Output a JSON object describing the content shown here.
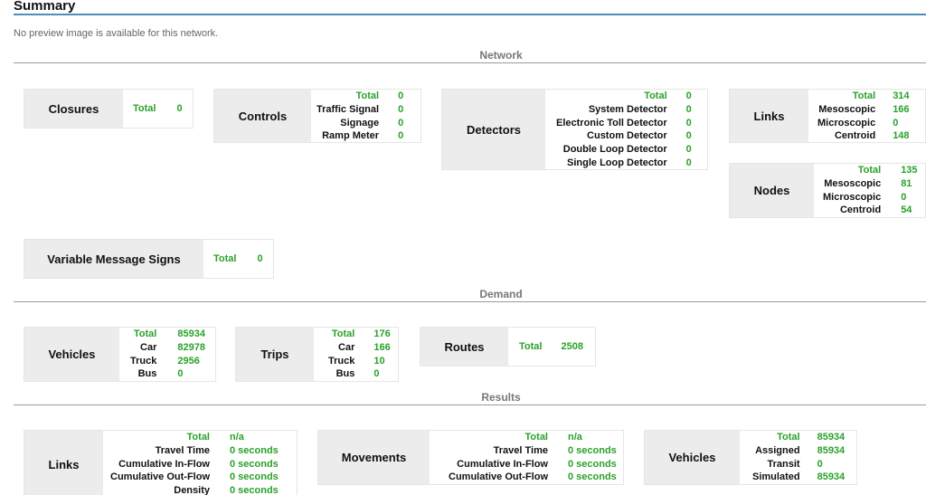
{
  "summary": {
    "title": "Summary",
    "no_preview": "No preview image is available for this network."
  },
  "sections": {
    "network": "Network",
    "demand": "Demand",
    "results": "Results"
  },
  "network": {
    "closures": {
      "label": "Closures",
      "total_label": "Total",
      "total": "0"
    },
    "controls": {
      "label": "Controls",
      "rows": [
        {
          "k": "Total",
          "v": "0"
        },
        {
          "k": "Traffic Signal",
          "v": "0"
        },
        {
          "k": "Signage",
          "v": "0"
        },
        {
          "k": "Ramp Meter",
          "v": "0"
        }
      ]
    },
    "detectors": {
      "label": "Detectors",
      "rows": [
        {
          "k": "Total",
          "v": "0"
        },
        {
          "k": "System Detector",
          "v": "0"
        },
        {
          "k": "Electronic Toll Detector",
          "v": "0"
        },
        {
          "k": "Custom Detector",
          "v": "0"
        },
        {
          "k": "Double Loop Detector",
          "v": "0"
        },
        {
          "k": "Single Loop Detector",
          "v": "0"
        }
      ]
    },
    "links": {
      "label": "Links",
      "rows": [
        {
          "k": "Total",
          "v": "314"
        },
        {
          "k": "Mesoscopic",
          "v": "166"
        },
        {
          "k": "Microscopic",
          "v": "0"
        },
        {
          "k": "Centroid",
          "v": "148"
        }
      ]
    },
    "nodes": {
      "label": "Nodes",
      "rows": [
        {
          "k": "Total",
          "v": "135"
        },
        {
          "k": "Mesoscopic",
          "v": "81"
        },
        {
          "k": "Microscopic",
          "v": "0"
        },
        {
          "k": "Centroid",
          "v": "54"
        }
      ]
    },
    "vms": {
      "label": "Variable Message Signs",
      "total_label": "Total",
      "total": "0"
    }
  },
  "demand": {
    "vehicles": {
      "label": "Vehicles",
      "rows": [
        {
          "k": "Total",
          "v": "85934"
        },
        {
          "k": "Car",
          "v": "82978"
        },
        {
          "k": "Truck",
          "v": "2956"
        },
        {
          "k": "Bus",
          "v": "0"
        }
      ]
    },
    "trips": {
      "label": "Trips",
      "rows": [
        {
          "k": "Total",
          "v": "176"
        },
        {
          "k": "Car",
          "v": "166"
        },
        {
          "k": "Truck",
          "v": "10"
        },
        {
          "k": "Bus",
          "v": "0"
        }
      ]
    },
    "routes": {
      "label": "Routes",
      "total_label": "Total",
      "total": "2508"
    }
  },
  "results": {
    "links": {
      "label": "Links",
      "rows": [
        {
          "k": "Total",
          "v": "n/a"
        },
        {
          "k": "Travel Time",
          "v": "0 seconds"
        },
        {
          "k": "Cumulative In-Flow",
          "v": "0 seconds"
        },
        {
          "k": "Cumulative Out-Flow",
          "v": "0 seconds"
        },
        {
          "k": "Density",
          "v": "0 seconds"
        }
      ]
    },
    "movements": {
      "label": "Movements",
      "rows": [
        {
          "k": "Total",
          "v": "n/a"
        },
        {
          "k": "Travel Time",
          "v": "0 seconds"
        },
        {
          "k": "Cumulative In-Flow",
          "v": "0 seconds"
        },
        {
          "k": "Cumulative Out-Flow",
          "v": "0 seconds"
        }
      ]
    },
    "vehicles": {
      "label": "Vehicles",
      "rows": [
        {
          "k": "Total",
          "v": "85934"
        },
        {
          "k": "Assigned",
          "v": "85934"
        },
        {
          "k": "Transit",
          "v": "0"
        },
        {
          "k": "Simulated",
          "v": "85934"
        }
      ]
    }
  }
}
